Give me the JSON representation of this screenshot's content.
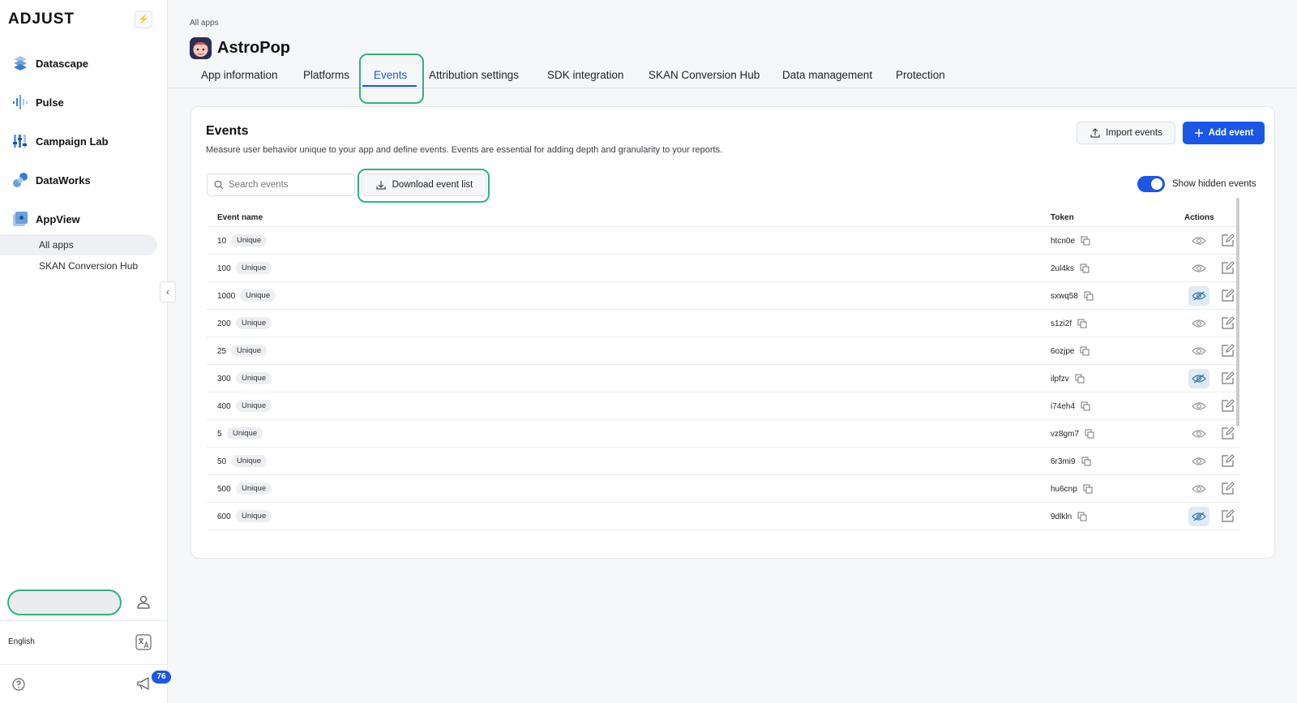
{
  "sidebar": {
    "logo": "ADJUST",
    "collapse_glyph": "⚡",
    "items": [
      {
        "label": "Datascape",
        "icon": "datascape-icon"
      },
      {
        "label": "Pulse",
        "icon": "pulse-icon"
      },
      {
        "label": "Campaign Lab",
        "icon": "campaign-lab-icon"
      },
      {
        "label": "DataWorks",
        "icon": "dataworks-icon"
      },
      {
        "label": "AppView",
        "icon": "appview-icon"
      }
    ],
    "subitems": [
      {
        "label": "All apps",
        "active": true
      },
      {
        "label": "SKAN Conversion Hub",
        "active": false
      }
    ],
    "language": "English",
    "notification_count": "76"
  },
  "header": {
    "breadcrumb": "All apps",
    "app_name": "AstroPop",
    "tabs": [
      {
        "label": "App information",
        "active": false
      },
      {
        "label": "Platforms",
        "active": false
      },
      {
        "label": "Events",
        "active": true
      },
      {
        "label": "Attribution settings",
        "active": false
      },
      {
        "label": "SDK integration",
        "active": false
      },
      {
        "label": "SKAN Conversion Hub",
        "active": false
      },
      {
        "label": "Data management",
        "active": false
      },
      {
        "label": "Protection",
        "active": false
      }
    ]
  },
  "events": {
    "title": "Events",
    "description": "Measure user behavior unique to your app and define events. Events are essential for adding depth and granularity to your reports.",
    "import_label": "Import events",
    "add_label": "Add event",
    "search_placeholder": "Search events",
    "download_label": "Download event list",
    "show_hidden_label": "Show hidden events",
    "show_hidden_on": true,
    "columns": {
      "name": "Event name",
      "token": "Token",
      "actions": "Actions"
    },
    "rows": [
      {
        "name": "10",
        "tag": "Unique",
        "token": "htcn0e",
        "hidden": false
      },
      {
        "name": "100",
        "tag": "Unique",
        "token": "2ul4ks",
        "hidden": false
      },
      {
        "name": "1000",
        "tag": "Unique",
        "token": "sxwq58",
        "hidden": true
      },
      {
        "name": "200",
        "tag": "Unique",
        "token": "s1zi2f",
        "hidden": false
      },
      {
        "name": "25",
        "tag": "Unique",
        "token": "6ozjpe",
        "hidden": false
      },
      {
        "name": "300",
        "tag": "Unique",
        "token": "ilpfzv",
        "hidden": true
      },
      {
        "name": "400",
        "tag": "Unique",
        "token": "i74eh4",
        "hidden": false
      },
      {
        "name": "5",
        "tag": "Unique",
        "token": "vz8gm7",
        "hidden": false
      },
      {
        "name": "50",
        "tag": "Unique",
        "token": "6r3mi9",
        "hidden": false
      },
      {
        "name": "500",
        "tag": "Unique",
        "token": "hu6cnp",
        "hidden": false
      },
      {
        "name": "600",
        "tag": "Unique",
        "token": "9dlkln",
        "hidden": true
      }
    ]
  },
  "colors": {
    "accent": "#1a57e6",
    "highlight": "#2fb37f"
  }
}
